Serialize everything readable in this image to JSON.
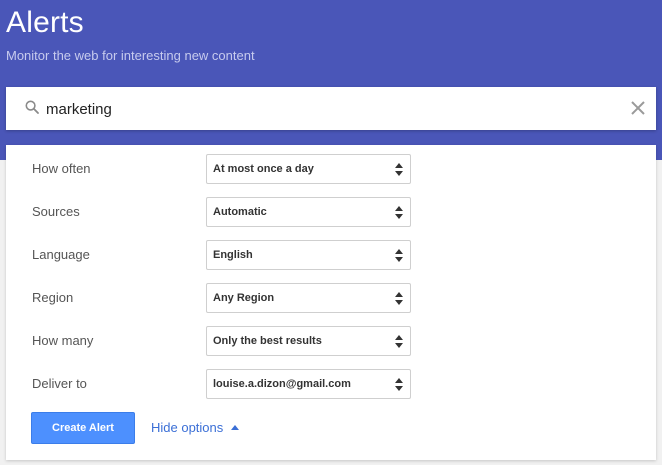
{
  "header": {
    "title": "Alerts",
    "subtitle": "Monitor the web for interesting new content"
  },
  "search": {
    "value": "marketing",
    "icon": "search-icon",
    "clear_icon": "close-icon"
  },
  "options": [
    {
      "label": "How often",
      "value": "At most once a day"
    },
    {
      "label": "Sources",
      "value": "Automatic"
    },
    {
      "label": "Language",
      "value": "English"
    },
    {
      "label": "Region",
      "value": "Any Region"
    },
    {
      "label": "How many",
      "value": "Only the best results"
    },
    {
      "label": "Deliver to",
      "value": "louise.a.dizon@gmail.com"
    }
  ],
  "actions": {
    "create_label": "Create Alert",
    "hide_options_label": "Hide options"
  },
  "colors": {
    "header_bg": "#4a56b8",
    "button_bg": "#4d90fe",
    "link": "#3b6fd6"
  }
}
